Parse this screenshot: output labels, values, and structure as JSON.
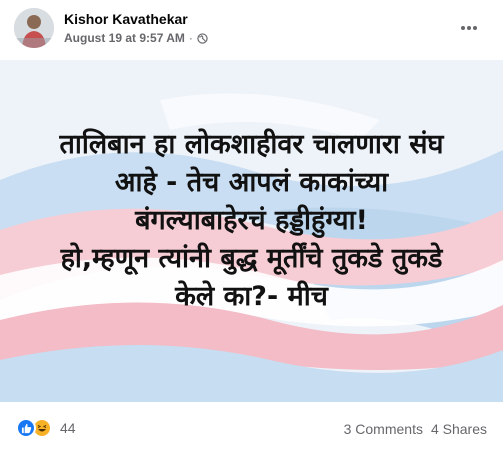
{
  "author": {
    "name": "Kishor Kavathekar"
  },
  "post_meta": {
    "timestamp": "August 19 at 9:57 AM",
    "separator": "·",
    "privacy_icon": "globe-icon"
  },
  "menu_icon": "more-options-icon",
  "image_text": {
    "lines": [
      "तालिबान हा लोकशाहीवर चालणारा संघ",
      "आहे - तेच आपलं काकांच्या",
      "बंगल्याबाहेरचं हड्डीहुंग्या!",
      "हो,म्हणून त्यांनी बुद्ध मूर्तींचे तुकडे तुकडे",
      "केले का?- मीच"
    ]
  },
  "reactions": {
    "types": [
      "like-icon",
      "haha-icon"
    ],
    "count": "44"
  },
  "counts": {
    "comments": "3 Comments",
    "shares": "4 Shares"
  },
  "colors": {
    "flag_blue": "#b7d4ef",
    "flag_pink": "#f3b9c3",
    "flag_white": "#ffffff",
    "like_blue": "#1877f2",
    "haha_yellow": "#f7b125"
  }
}
